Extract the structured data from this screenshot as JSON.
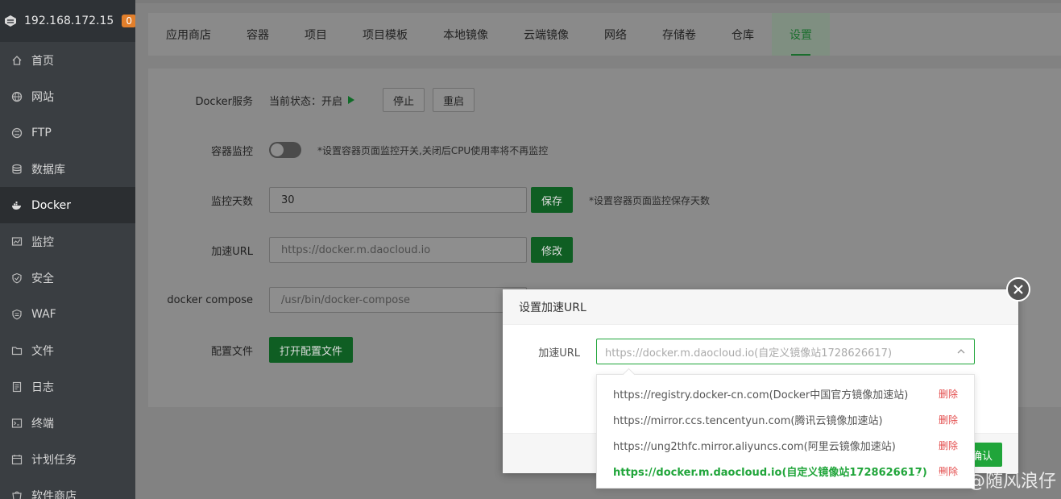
{
  "sidebar": {
    "ip": "192.168.172.15",
    "badge": "0",
    "items": [
      {
        "label": "首页",
        "icon": "home-icon"
      },
      {
        "label": "网站",
        "icon": "globe-icon"
      },
      {
        "label": "FTP",
        "icon": "ftp-icon"
      },
      {
        "label": "数据库",
        "icon": "database-icon"
      },
      {
        "label": "Docker",
        "icon": "docker-icon"
      },
      {
        "label": "监控",
        "icon": "monitor-icon"
      },
      {
        "label": "安全",
        "icon": "shield-icon"
      },
      {
        "label": "WAF",
        "icon": "waf-icon"
      },
      {
        "label": "文件",
        "icon": "folder-icon"
      },
      {
        "label": "日志",
        "icon": "log-icon"
      },
      {
        "label": "终端",
        "icon": "terminal-icon"
      },
      {
        "label": "计划任务",
        "icon": "calendar-icon"
      },
      {
        "label": "软件商店",
        "icon": "store-icon"
      }
    ],
    "active_index": 4
  },
  "tabs": [
    "应用商店",
    "容器",
    "项目",
    "项目模板",
    "本地镜像",
    "云端镜像",
    "网络",
    "存储卷",
    "仓库",
    "设置"
  ],
  "active_tab": 9,
  "settings": {
    "docker_service": {
      "label": "Docker服务",
      "status_text": "当前状态：开启",
      "stop": "停止",
      "restart": "重启"
    },
    "container_monitor": {
      "label": "容器监控",
      "hint": "*设置容器页面监控开关,关闭后CPU使用率将不再监控"
    },
    "monitor_days": {
      "label": "监控天数",
      "value": "30",
      "save": "保存",
      "hint": "*设置容器页面监控保存天数"
    },
    "accel_url": {
      "label": "加速URL",
      "placeholder": "https://docker.m.daocloud.io",
      "modify": "修改"
    },
    "compose": {
      "label": "docker compose",
      "placeholder": "/usr/bin/docker-compose"
    },
    "config_file": {
      "label": "配置文件",
      "button": "打开配置文件"
    }
  },
  "modal": {
    "title": "设置加速URL",
    "field_label": "加速URL",
    "select_placeholder": "https://docker.m.daocloud.io(自定义镜像站1728626617)",
    "confirm": "确认",
    "options": [
      {
        "text": "https://registry.docker-cn.com(Docker中国官方镜像加速站)",
        "delete": "删除"
      },
      {
        "text": "https://mirror.ccs.tencentyun.com(腾讯云镜像加速站)",
        "delete": "删除"
      },
      {
        "text": "https://ung2thfc.mirror.aliyuncs.com(阿里云镜像加速站)",
        "delete": "删除"
      },
      {
        "text": "https://docker.m.daocloud.io(自定义镜像站1728626617)",
        "delete": "删除"
      }
    ],
    "selected_index": 3
  },
  "watermark": "CSDN @随风浪仔"
}
